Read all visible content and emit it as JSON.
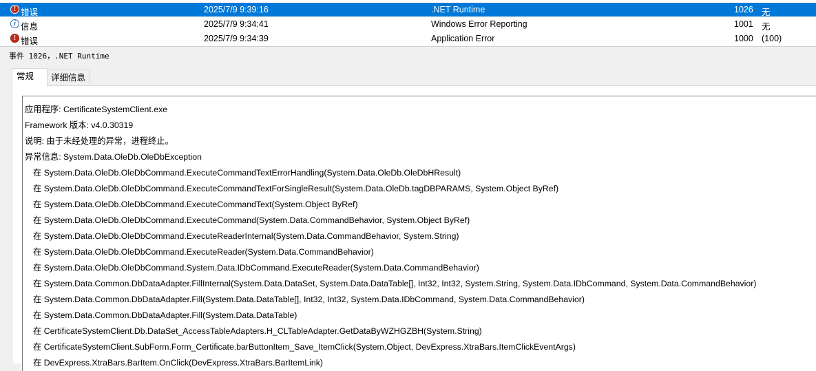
{
  "events": [
    {
      "level": "错误",
      "level_type": "error",
      "date": "2025/7/9 9:39:16",
      "source": ".NET Runtime",
      "event_id": "1026",
      "task": "无",
      "selected": true
    },
    {
      "level": "信息",
      "level_type": "info",
      "date": "2025/7/9 9:34:41",
      "source": "Windows Error Reporting",
      "event_id": "1001",
      "task": "无",
      "selected": false
    },
    {
      "level": "错误",
      "level_type": "error",
      "date": "2025/7/9 9:34:39",
      "source": "Application Error",
      "event_id": "1000",
      "task": "(100)",
      "selected": false
    }
  ],
  "detail": {
    "header": "事件 1026，.NET Runtime",
    "tabs": [
      "常规",
      "详细信息"
    ],
    "lines": [
      "应用程序: CertificateSystemClient.exe",
      "Framework 版本: v4.0.30319",
      "说明: 由于未经处理的异常，进程终止。",
      "异常信息: System.Data.OleDb.OleDbException",
      "在 System.Data.OleDb.OleDbCommand.ExecuteCommandTextErrorHandling(System.Data.OleDb.OleDbHResult)",
      "在 System.Data.OleDb.OleDbCommand.ExecuteCommandTextForSingleResult(System.Data.OleDb.tagDBPARAMS, System.Object ByRef)",
      "在 System.Data.OleDb.OleDbCommand.ExecuteCommandText(System.Object ByRef)",
      "在 System.Data.OleDb.OleDbCommand.ExecuteCommand(System.Data.CommandBehavior, System.Object ByRef)",
      "在 System.Data.OleDb.OleDbCommand.ExecuteReaderInternal(System.Data.CommandBehavior, System.String)",
      "在 System.Data.OleDb.OleDbCommand.ExecuteReader(System.Data.CommandBehavior)",
      "在 System.Data.OleDb.OleDbCommand.System.Data.IDbCommand.ExecuteReader(System.Data.CommandBehavior)",
      "在 System.Data.Common.DbDataAdapter.FillInternal(System.Data.DataSet, System.Data.DataTable[], Int32, Int32, System.String, System.Data.IDbCommand, System.Data.CommandBehavior)",
      "在 System.Data.Common.DbDataAdapter.Fill(System.Data.DataTable[], Int32, Int32, System.Data.IDbCommand, System.Data.CommandBehavior)",
      "在 System.Data.Common.DbDataAdapter.Fill(System.Data.DataTable)",
      "在 CertificateSystemClient.Db.DataSet_AccessTableAdapters.H_CLTableAdapter.GetDataByWZHGZBH(System.String)",
      "在 CertificateSystemClient.SubForm.Form_Certificate.barButtonItem_Save_ItemClick(System.Object, DevExpress.XtraBars.ItemClickEventArgs)",
      "在 DevExpress.XtraBars.BarItem.OnClick(DevExpress.XtraBars.BarItemLink)"
    ],
    "indented_from": 4
  },
  "colors": {
    "selection": "#0078d7",
    "error_icon": "#c42b1c",
    "info_icon": "#2b62b3"
  }
}
